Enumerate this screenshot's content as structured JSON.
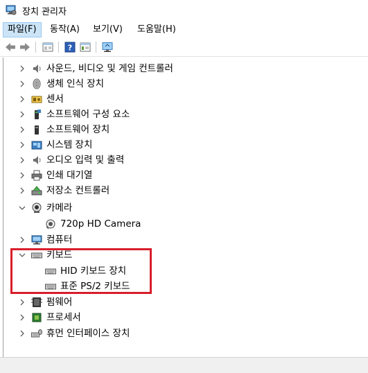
{
  "window": {
    "title": "장치 관리자"
  },
  "menu": [
    {
      "label": "파일(F)",
      "active": true
    },
    {
      "label": "동작(A)",
      "active": false
    },
    {
      "label": "보기(V)",
      "active": false
    },
    {
      "label": "도움말(H)",
      "active": false
    }
  ],
  "tree": [
    {
      "label": "사운드, 비디오 및 게임 컨트롤러",
      "state": "collapsed",
      "icon": "speaker-icon"
    },
    {
      "label": "생체 인식 장치",
      "state": "collapsed",
      "icon": "fingerprint-icon"
    },
    {
      "label": "센서",
      "state": "collapsed",
      "icon": "sensor-icon"
    },
    {
      "label": "소프트웨어 구성 요소",
      "state": "collapsed",
      "icon": "software-component-icon"
    },
    {
      "label": "소프트웨어 장치",
      "state": "collapsed",
      "icon": "software-device-icon"
    },
    {
      "label": "시스템 장치",
      "state": "collapsed",
      "icon": "system-device-icon"
    },
    {
      "label": "오디오 입력 및 출력",
      "state": "collapsed",
      "icon": "audio-icon"
    },
    {
      "label": "인쇄 대기열",
      "state": "collapsed",
      "icon": "printer-icon"
    },
    {
      "label": "저장소 컨트롤러",
      "state": "collapsed",
      "icon": "storage-controller-icon"
    },
    {
      "label": "카메라",
      "state": "expanded",
      "icon": "camera-icon"
    },
    {
      "label": "720p HD Camera",
      "state": "child",
      "icon": "webcam-icon"
    },
    {
      "label": "컴퓨터",
      "state": "collapsed",
      "icon": "computer-icon"
    },
    {
      "label": "키보드",
      "state": "expanded",
      "icon": "keyboard-icon"
    },
    {
      "label": "HID 키보드 장치",
      "state": "child",
      "icon": "keyboard-icon"
    },
    {
      "label": "표준 PS/2 키보드",
      "state": "child",
      "icon": "keyboard-icon"
    },
    {
      "label": "펌웨어",
      "state": "collapsed",
      "icon": "firmware-icon"
    },
    {
      "label": "프로세서",
      "state": "collapsed",
      "icon": "processor-icon"
    },
    {
      "label": "휴먼 인터페이스 장치",
      "state": "collapsed",
      "icon": "hid-icon"
    }
  ],
  "colors": {
    "highlight": "#d81e2a",
    "menu_active": "#cce4f7"
  }
}
